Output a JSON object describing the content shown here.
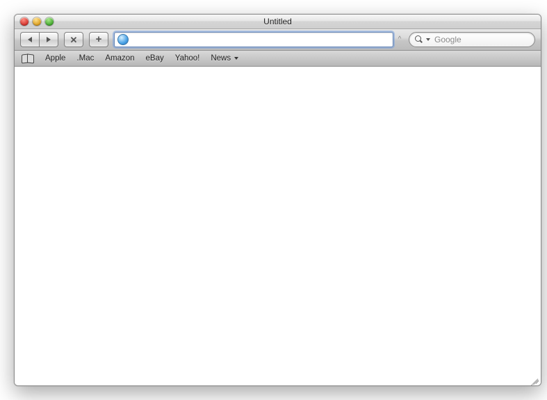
{
  "window": {
    "title": "Untitled"
  },
  "toolbar": {
    "url_value": "",
    "snapback_glyph": "^"
  },
  "search": {
    "placeholder": "Google",
    "value": ""
  },
  "bookmarks": {
    "items": [
      {
        "label": "Apple"
      },
      {
        "label": ".Mac"
      },
      {
        "label": "Amazon"
      },
      {
        "label": "eBay"
      },
      {
        "label": "Yahoo!"
      },
      {
        "label": "News",
        "has_menu": true
      }
    ]
  }
}
